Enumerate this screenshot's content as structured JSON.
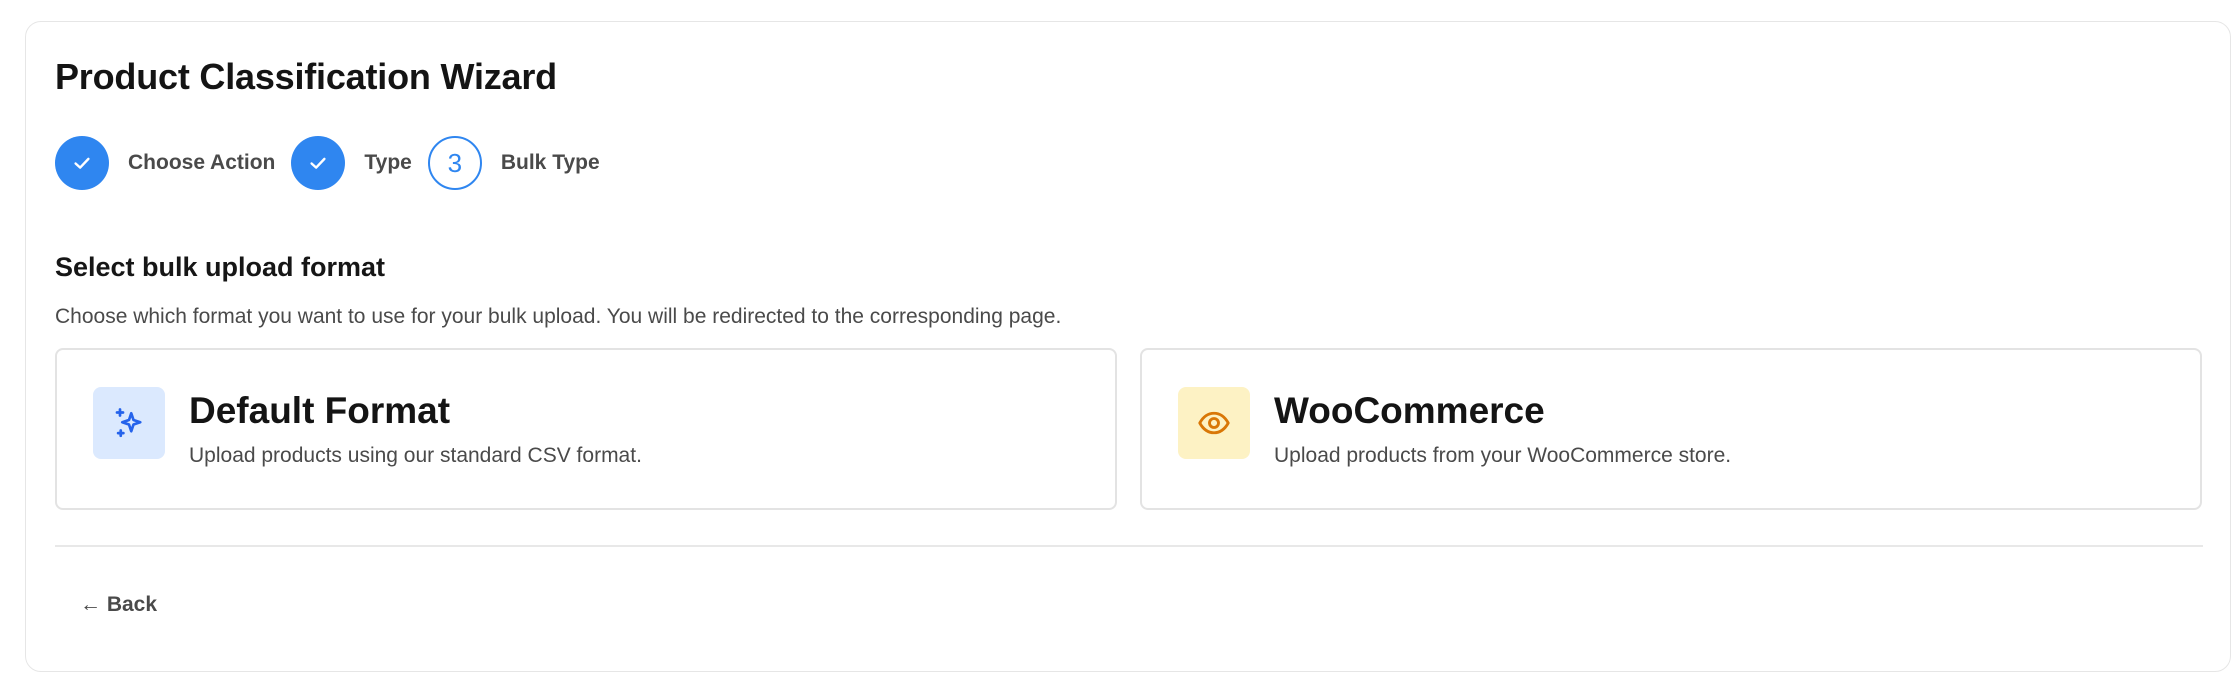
{
  "wizard": {
    "title": "Product Classification Wizard",
    "steps": [
      {
        "label": "Choose Action",
        "status": "completed"
      },
      {
        "label": "Type",
        "status": "completed"
      },
      {
        "label": "Bulk Type",
        "status": "current",
        "number": "3"
      }
    ]
  },
  "section": {
    "title": "Select bulk upload format",
    "description": "Choose which format you want to use for your bulk upload. You will be redirected to the corresponding page."
  },
  "options": [
    {
      "title": "Default Format",
      "description": "Upload products using our standard CSV format.",
      "icon": "sparkles-icon",
      "icon_color": "#2563eb",
      "icon_bg": "#dbe9fe"
    },
    {
      "title": "WooCommerce",
      "description": "Upload products from your WooCommerce store.",
      "icon": "eye-icon",
      "icon_color": "#d97706",
      "icon_bg": "#fdf2c4"
    }
  ],
  "footer": {
    "back_label": "← Back"
  },
  "colors": {
    "accent": "#2f86f0",
    "border": "#e3e3e3",
    "muted_text": "#4a4a4a"
  }
}
